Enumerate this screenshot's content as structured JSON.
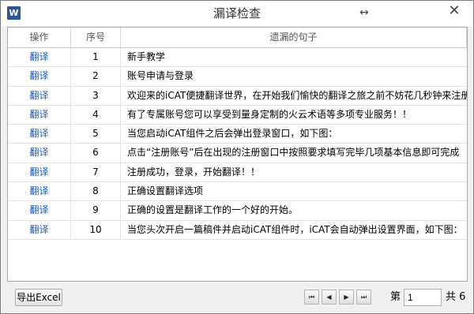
{
  "window": {
    "app_icon_letter": "W",
    "title": "漏译检查",
    "resize_glyph": "↔",
    "close_glyph": "✕"
  },
  "table": {
    "columns": [
      "操作",
      "序号",
      "遗漏的句子"
    ],
    "rows": [
      {
        "action": "翻译",
        "no": "1",
        "text": "新手教学"
      },
      {
        "action": "翻译",
        "no": "2",
        "text": "账号申请与登录"
      },
      {
        "action": "翻译",
        "no": "3",
        "text": "欢迎来的iCAT便捷翻译世界，在开始我们愉快的翻译之旅之前不妨花几秒钟来注册"
      },
      {
        "action": "翻译",
        "no": "4",
        "text": "有了专属账号您可以享受到量身定制的火云术语等多项专业服务！！"
      },
      {
        "action": "翻译",
        "no": "5",
        "text": "当您启动iCAT组件之后会弹出登录窗口，如下图："
      },
      {
        "action": "翻译",
        "no": "6",
        "text": "点击“注册账号”后在出现的注册窗口中按照要求填写完毕几项基本信息即可完成"
      },
      {
        "action": "翻译",
        "no": "7",
        "text": "注册成功，登录，开始翻译！！"
      },
      {
        "action": "翻译",
        "no": "8",
        "text": "正确设置翻译选项"
      },
      {
        "action": "翻译",
        "no": "9",
        "text": "正确的设置是翻译工作的一个好的开始。"
      },
      {
        "action": "翻译",
        "no": "10",
        "text": "当您头次开启一篇稿件并启动iCAT组件时，iCAT会自动弹出设置界面，如下图："
      }
    ]
  },
  "footer": {
    "export_label": "导出Excel",
    "page_prefix": "第",
    "page_value": "1",
    "page_total": "共 6",
    "pager_first": "⏮",
    "pager_prev": "◀",
    "pager_next": "▶",
    "pager_last": "⏭"
  },
  "colors": {
    "action_link": "#1a58b4",
    "app_icon_bg": "#2b579a"
  }
}
